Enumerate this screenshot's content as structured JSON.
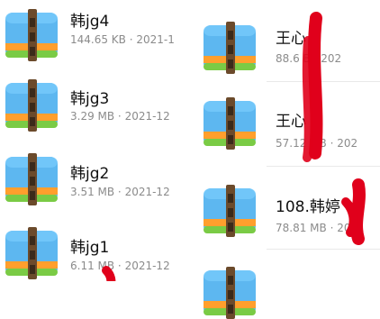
{
  "files": [
    {
      "name": "韩jg4",
      "meta": "144.65 KB · 2021-1"
    },
    {
      "name": "韩jg3",
      "meta": "3.29 MB · 2021-12"
    },
    {
      "name": "韩jg2",
      "meta": "3.51 MB · 2021-12"
    },
    {
      "name": "韩jg1",
      "meta": "6.11 MB · 2021-12"
    },
    {
      "name": "王心 1",
      "meta": "88.6 B · 202"
    },
    {
      "name": "王心 2",
      "meta": "57.12 MB · 202"
    },
    {
      "name": "108.韩婷",
      "meta": "78.81 MB · 202"
    }
  ],
  "icons": {
    "archive": "archive-icon"
  },
  "colors": {
    "title": "#111111",
    "meta": "#8b8b8b",
    "redact": "#e0001b",
    "blue": "#5db7f0",
    "orange": "#ff9f2d",
    "green": "#7acb45"
  }
}
